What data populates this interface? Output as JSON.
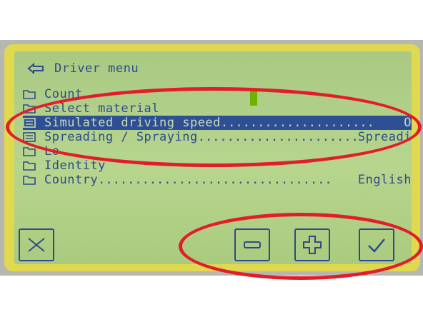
{
  "title": "Driver menu",
  "items": [
    {
      "label": "Count",
      "value": "",
      "icon": "folder-icon",
      "selected": false
    },
    {
      "label": "Select material",
      "value": "",
      "icon": "folder-icon",
      "selected": false
    },
    {
      "label": "Simulated driving speed",
      "value": "O",
      "icon": "list-icon",
      "selected": true
    },
    {
      "label": "Spreading / Spraying",
      "value": "Spreadi",
      "icon": "list-icon",
      "selected": false
    },
    {
      "label": "Lo",
      "value": "",
      "icon": "folder-icon",
      "selected": false
    },
    {
      "label": "Identity",
      "value": "",
      "icon": "folder-icon",
      "selected": false
    },
    {
      "label": "Country",
      "value": "English",
      "icon": "folder-icon",
      "selected": false
    }
  ],
  "softkeys": [
    {
      "name": "close-button",
      "icon": "close-icon"
    },
    {
      "name": "decrease-button",
      "icon": "minus-icon"
    },
    {
      "name": "increase-button",
      "icon": "plus-icon"
    },
    {
      "name": "confirm-button",
      "icon": "checkmark-icon"
    }
  ],
  "colors": {
    "lcd_background": "#b7d58d",
    "lcd_text": "#2e4a8c",
    "selection_bar": "#2f4f95",
    "frame": "#e0d94f",
    "highlight_annotation": "#e21c2a",
    "cursor": "#6cb400"
  }
}
